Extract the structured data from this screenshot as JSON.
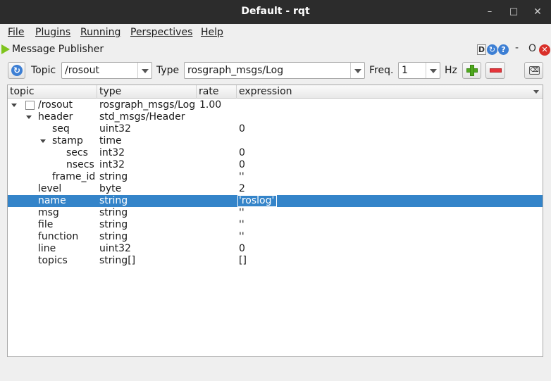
{
  "window": {
    "title": "Default - rqt",
    "min_glyph": "–",
    "max_glyph": "□",
    "close_glyph": "✕"
  },
  "menu": [
    "File",
    "Plugins",
    "Running",
    "Perspectives",
    "Help"
  ],
  "plugin": {
    "title": "Message Publisher",
    "d_label": "D",
    "reload_glyph": "↻",
    "help_glyph": "?",
    "minus_glyph": "-",
    "o_label": "O",
    "close_glyph": "✕"
  },
  "toolbar": {
    "refresh_glyph": "↻",
    "topic_label": "Topic",
    "topic_value": "/rosout",
    "type_label": "Type",
    "type_value": "rosgraph_msgs/Log",
    "freq_label": "Freq.",
    "freq_value": "1",
    "hz_label": "Hz",
    "clear_glyph": "⌫"
  },
  "tree": {
    "columns": [
      "topic",
      "type",
      "rate",
      "expression"
    ],
    "rows": [
      {
        "topic": "/rosout",
        "type": "rosgraph_msgs/Log",
        "rate": "1.00",
        "expression": ""
      },
      {
        "topic": "header",
        "type": "std_msgs/Header",
        "rate": "",
        "expression": ""
      },
      {
        "topic": "seq",
        "type": "uint32",
        "rate": "",
        "expression": "0"
      },
      {
        "topic": "stamp",
        "type": "time",
        "rate": "",
        "expression": ""
      },
      {
        "topic": "secs",
        "type": "int32",
        "rate": "",
        "expression": "0"
      },
      {
        "topic": "nsecs",
        "type": "int32",
        "rate": "",
        "expression": "0"
      },
      {
        "topic": "frame_id",
        "type": "string",
        "rate": "",
        "expression": "''"
      },
      {
        "topic": "level",
        "type": "byte",
        "rate": "",
        "expression": "2"
      },
      {
        "topic": "name",
        "type": "string",
        "rate": "",
        "expression": "'roslog'"
      },
      {
        "topic": "msg",
        "type": "string",
        "rate": "",
        "expression": "''"
      },
      {
        "topic": "file",
        "type": "string",
        "rate": "",
        "expression": "''"
      },
      {
        "topic": "function",
        "type": "string",
        "rate": "",
        "expression": "''"
      },
      {
        "topic": "line",
        "type": "uint32",
        "rate": "",
        "expression": "0"
      },
      {
        "topic": "topics",
        "type": "string[]",
        "rate": "",
        "expression": "[]"
      }
    ]
  }
}
